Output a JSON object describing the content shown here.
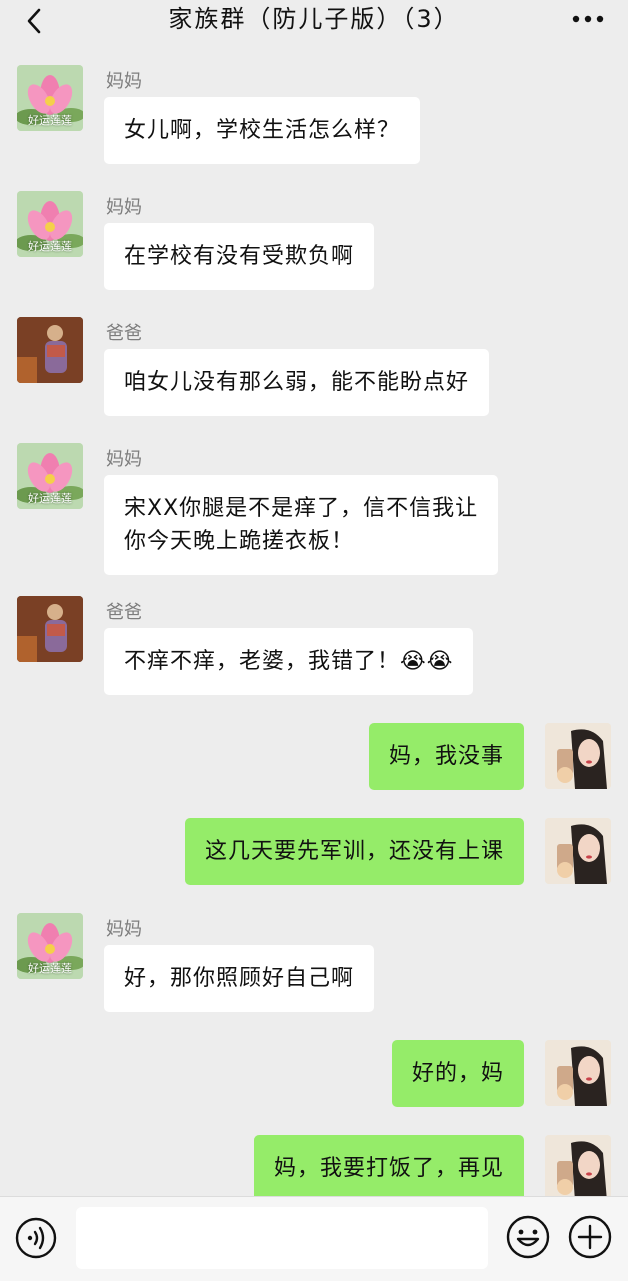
{
  "header": {
    "title": "家族群（防儿子版）（3）",
    "back_icon": "chevron-left-icon",
    "more_icon": "ellipsis-icon"
  },
  "avatars": {
    "mom_caption": "好运莲莲"
  },
  "messages": [
    {
      "dir": "in",
      "avatar": "mom",
      "sender": "妈妈",
      "text": "女儿啊，学校生活怎么样？"
    },
    {
      "dir": "in",
      "avatar": "mom",
      "sender": "妈妈",
      "text": "在学校有没有受欺负啊"
    },
    {
      "dir": "in",
      "avatar": "dad",
      "sender": "爸爸",
      "text": "咱女儿没有那么弱，能不能盼点好"
    },
    {
      "dir": "in",
      "avatar": "mom",
      "sender": "妈妈",
      "text": "宋XX你腿是不是痒了，信不信我让\n你今天晚上跪搓衣板！"
    },
    {
      "dir": "in",
      "avatar": "dad",
      "sender": "爸爸",
      "text": "不痒不痒，老婆，我错了！😭😭"
    },
    {
      "dir": "out",
      "avatar": "me",
      "sender": "",
      "text": "妈，我没事"
    },
    {
      "dir": "out",
      "avatar": "me",
      "sender": "",
      "text": "这几天要先军训，还没有上课"
    },
    {
      "dir": "in",
      "avatar": "mom",
      "sender": "妈妈",
      "text": "好，那你照顾好自己啊"
    },
    {
      "dir": "out",
      "avatar": "me",
      "sender": "",
      "text": "好的，妈"
    },
    {
      "dir": "out",
      "avatar": "me",
      "sender": "",
      "text": "妈，我要打饭了，再见"
    }
  ],
  "input": {
    "value": "",
    "placeholder": ""
  },
  "toolbar": {
    "voice_icon": "voice-icon",
    "emoji_icon": "emoji-icon",
    "plus_icon": "plus-icon"
  },
  "colors": {
    "background": "#ededed",
    "incoming_bubble": "#ffffff",
    "outgoing_bubble": "#95ec69",
    "sender_name": "#7d7d7d"
  }
}
